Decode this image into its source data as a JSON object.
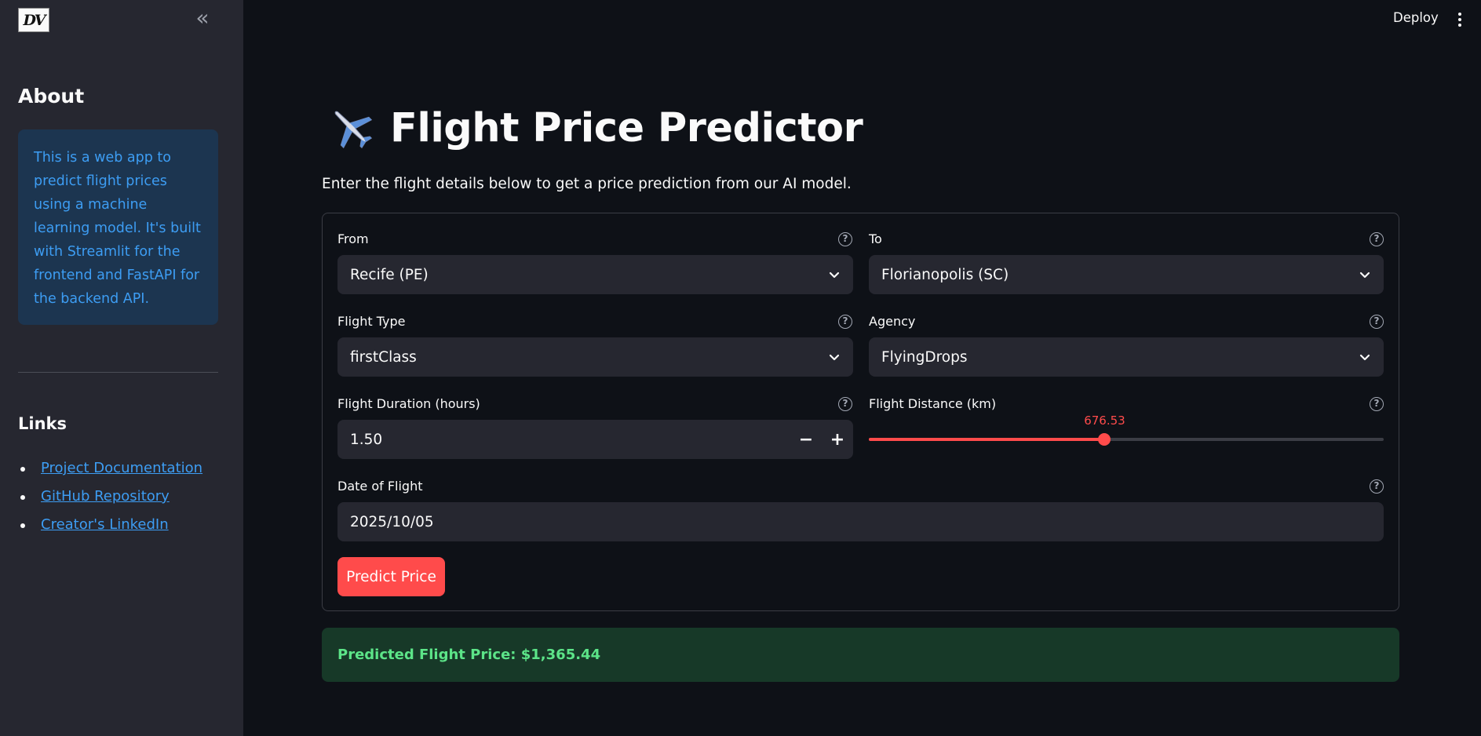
{
  "sidebar": {
    "logo_text": "DV",
    "collapse_icon": "double-chevron-left-icon",
    "about_heading": "About",
    "about_text": "This is a web app to predict flight prices using a machine learning model. It's built with Streamlit for the frontend and FastAPI for the backend API.",
    "links_heading": "Links",
    "links": [
      {
        "label": "Project Documentation"
      },
      {
        "label": "GitHub Repository"
      },
      {
        "label": "Creator's LinkedIn"
      }
    ]
  },
  "header": {
    "deploy_label": "Deploy",
    "menu_icon": "kebab-menu-icon"
  },
  "main": {
    "title": "Flight Price Predictor",
    "title_icon": "airplane-icon",
    "subtitle": "Enter the flight details below to get a price prediction from our AI model.",
    "form": {
      "from": {
        "label": "From",
        "value": "Recife (PE)"
      },
      "to": {
        "label": "To",
        "value": "Florianopolis (SC)"
      },
      "flight_type": {
        "label": "Flight Type",
        "value": "firstClass"
      },
      "agency": {
        "label": "Agency",
        "value": "FlyingDrops"
      },
      "duration": {
        "label": "Flight Duration (hours)",
        "value": "1.50",
        "minus": "−",
        "plus": "+"
      },
      "distance": {
        "label": "Flight Distance (km)",
        "value": "676.53",
        "fraction": 0.458
      },
      "date": {
        "label": "Date of Flight",
        "value": "2025/10/05"
      },
      "help_glyph": "?"
    },
    "predict_button": "Predict Price",
    "result": "Predicted Flight Price: $1,365.44"
  },
  "colors": {
    "accent": "#ff4b4b",
    "info_text": "#3d9df3",
    "success_text": "#5ce488",
    "background": "#0e1117",
    "sidebar_bg": "#262730"
  }
}
